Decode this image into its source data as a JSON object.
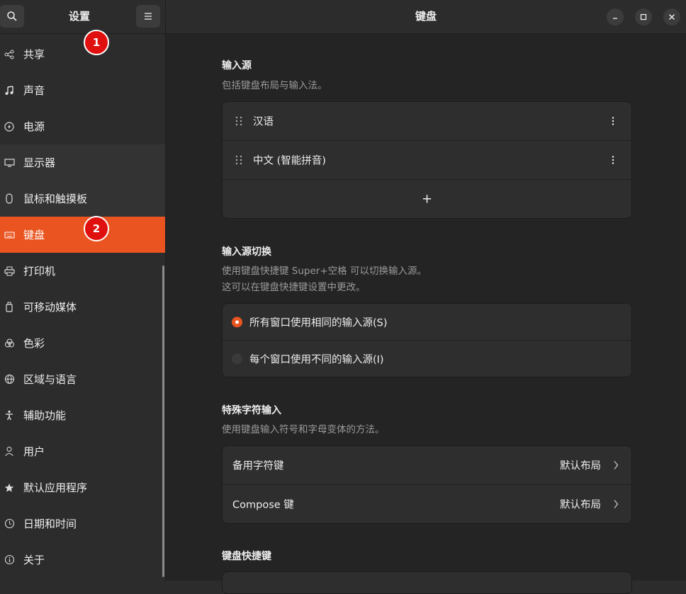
{
  "sidebar": {
    "title": "设置",
    "search_icon": "search-icon",
    "menu_icon": "hamburger-menu-icon",
    "items": [
      {
        "label": "共享",
        "icon": "share-icon"
      },
      {
        "label": "声音",
        "icon": "music-note-icon"
      },
      {
        "label": "电源",
        "icon": "power-icon"
      },
      {
        "label": "显示器",
        "icon": "display-icon"
      },
      {
        "label": "鼠标和触摸板",
        "icon": "mouse-icon"
      },
      {
        "label": "键盘",
        "icon": "keyboard-icon",
        "active": true
      },
      {
        "label": "打印机",
        "icon": "printer-icon"
      },
      {
        "label": "可移动媒体",
        "icon": "usb-drive-icon"
      },
      {
        "label": "色彩",
        "icon": "color-icon"
      },
      {
        "label": "区域与语言",
        "icon": "globe-icon"
      },
      {
        "label": "辅助功能",
        "icon": "accessibility-icon"
      },
      {
        "label": "用户",
        "icon": "user-icon"
      },
      {
        "label": "默认应用程序",
        "icon": "star-icon"
      },
      {
        "label": "日期和时间",
        "icon": "clock-icon"
      },
      {
        "label": "关于",
        "icon": "info-icon"
      }
    ]
  },
  "badges": [
    "1",
    "2"
  ],
  "window": {
    "title": "键盘"
  },
  "input_sources": {
    "title": "输入源",
    "desc": "包括键盘布局与输入法。",
    "items": [
      "汉语",
      "中文 (智能拼音)"
    ],
    "add_label": "+"
  },
  "switching": {
    "title": "输入源切换",
    "desc_line1": "使用键盘快捷键 Super+空格 可以切换输入源。",
    "desc_line2": "这可以在键盘快捷键设置中更改。",
    "options": [
      {
        "label": "所有窗口使用相同的输入源(S)",
        "selected": true
      },
      {
        "label": "每个窗口使用不同的输入源(I)",
        "selected": false
      }
    ]
  },
  "special_chars": {
    "title": "特殊字符输入",
    "desc": "使用键盘输入符号和字母变体的方法。",
    "rows": [
      {
        "label": "备用字符键",
        "value": "默认布局"
      },
      {
        "label": "Compose 键",
        "value": "默认布局"
      }
    ]
  },
  "shortcuts": {
    "title": "键盘快捷键"
  },
  "colors": {
    "accent": "#e95420",
    "badge": "#e0100f"
  }
}
